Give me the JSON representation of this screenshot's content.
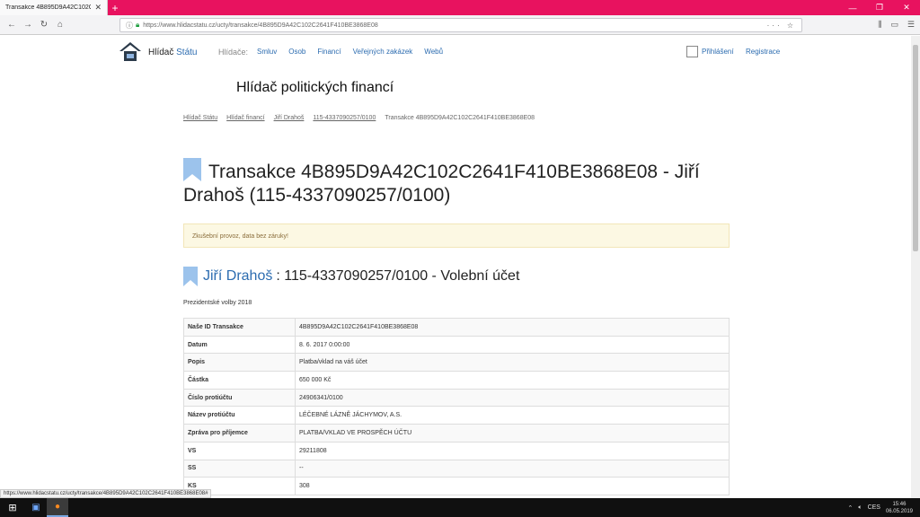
{
  "browser": {
    "tab_title": "Transakce 4B895D9A42C102C2641F",
    "url": "https://www.hlidacstatu.cz/ucty/transakce/4B895D9A42C102C2641F410BE3868E08"
  },
  "site": {
    "brand_main": "Hlídač",
    "brand_accent": "Státu",
    "watch_label": "Hlídače:",
    "nav": [
      "Smluv",
      "Osob",
      "Financí",
      "Veřejných zakázek",
      "Webů"
    ],
    "login": "Přihlášení",
    "register": "Registrace",
    "subtitle": "Hlídač politických financí"
  },
  "breadcrumb": [
    "Hlídač Státu",
    "Hlídač financí",
    "Jiří Drahoš",
    "115-4337090257/0100"
  ],
  "breadcrumb_current": "Transakce 4B895D9A42C102C2641F410BE3868E08",
  "page_title": "Transakce 4B895D9A42C102C2641F410BE3868E08 - Jiří Drahoš (115-4337090257/0100)",
  "alert": "Zkušební provoz, data bez záruky!",
  "account": {
    "owner": "Jiří Drahoš",
    "rest": ": 115-4337090257/0100 - Volební účet",
    "election": "Prezidentské volby 2018"
  },
  "details": [
    {
      "key": "Naše ID Transakce",
      "value": "4B895D9A42C102C2641F410BE3868E08"
    },
    {
      "key": "Datum",
      "value": "8. 6. 2017 0:00:00"
    },
    {
      "key": "Popis",
      "value": "Platba/vklad na váš účet"
    },
    {
      "key": "Částka",
      "value": "650 000 Kč"
    },
    {
      "key": "Číslo protiúčtu",
      "value": "24906341/0100"
    },
    {
      "key": "Název protiúčtu",
      "value": "LÉČEBNÉ LÁZNĚ JÁCHYMOV, A.S."
    },
    {
      "key": "Zpráva pro příjemce",
      "value": "PLATBA/VKLAD VE PROSPĚCH ÚČTU"
    },
    {
      "key": "VS",
      "value": "29211808"
    },
    {
      "key": "SS",
      "value": "--"
    },
    {
      "key": "KS",
      "value": "308"
    }
  ],
  "statusbar": "https://www.hlidacstatu.cz/ucty/transakce/4B895D9A42C102C2641F410BE3868E08#",
  "taskbar": {
    "lang": "CES",
    "time": "15:46",
    "date": "06.05.2019"
  },
  "colors": {
    "accent": "#2c6cb0",
    "tabbar": "#e8125f"
  },
  "icons": [
    "back-icon",
    "forward-icon",
    "reload-icon",
    "home-icon",
    "lock-icon",
    "bookmark-icon",
    "library-icon",
    "menu-icon",
    "windows-start-icon",
    "firefox-icon",
    "save-icon"
  ]
}
